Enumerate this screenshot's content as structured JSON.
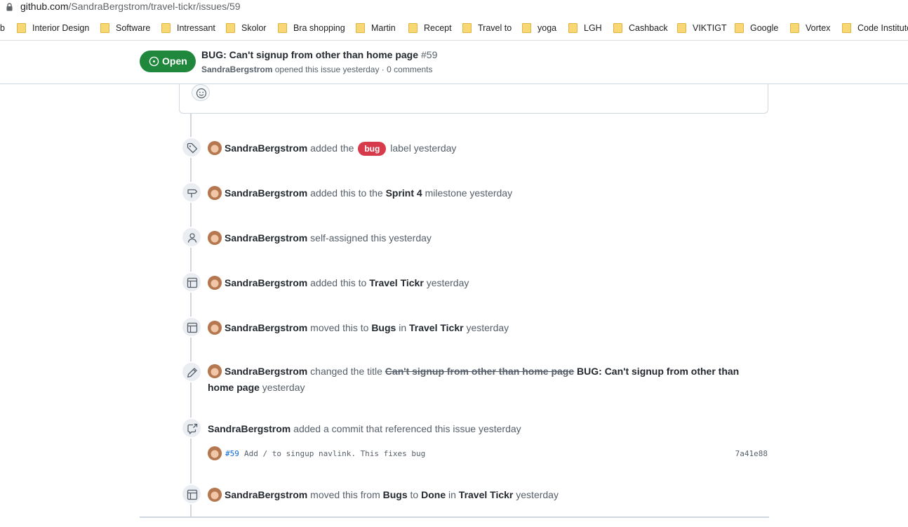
{
  "browser": {
    "url_host": "github.com",
    "url_path": "/SandraBergstrom/travel-tickr/issues/59",
    "bookmark_cut": "b",
    "bookmarks": [
      {
        "label": "Interior Design"
      },
      {
        "label": "Software"
      },
      {
        "label": "Intressant"
      },
      {
        "label": "Skolor"
      },
      {
        "label": "Bra shopping"
      },
      {
        "label": "Martin"
      },
      {
        "label": "Recept"
      },
      {
        "label": "Travel to"
      },
      {
        "label": "yoga"
      },
      {
        "label": "LGH"
      },
      {
        "label": "Cashback"
      },
      {
        "label": "VIKTIGT"
      },
      {
        "label": "Google"
      },
      {
        "label": "Vortex"
      },
      {
        "label": "Code Institute"
      }
    ]
  },
  "issue": {
    "state": "Open",
    "title": "BUG: Can't signup from other than home page",
    "number": "#59",
    "author": "SandraBergstrom",
    "meta_rest": "opened this issue yesterday · 0 comments",
    "state_color": "#1f883d"
  },
  "timeline": {
    "actor": "SandraBergstrom",
    "events": [
      {
        "icon": "tag-icon",
        "pre": "added the",
        "label": "bug",
        "post": "label yesterday",
        "label_color": "#d73a4a"
      },
      {
        "icon": "milestone-icon",
        "pre": "added this to the",
        "strong1": "Sprint 4",
        "post": "milestone yesterday"
      },
      {
        "icon": "person-icon",
        "pre": "self-assigned this yesterday"
      },
      {
        "icon": "project-icon",
        "pre": "added this to",
        "strong1": "Travel Tickr",
        "post": "yesterday"
      },
      {
        "icon": "project-icon",
        "pre": "moved this to",
        "strong1": "Bugs",
        "mid": "in",
        "strong2": "Travel Tickr",
        "post": "yesterday"
      },
      {
        "icon": "pencil-icon",
        "pre": "changed the title",
        "old_title": "Can't signup from other than home page",
        "new_title": "BUG: Can't signup from other than home page",
        "post": "yesterday"
      },
      {
        "icon": "cross-reference-icon",
        "pre": "added a commit that referenced this issue yesterday"
      },
      {
        "icon": "project-icon",
        "pre": "moved this from",
        "strong1": "Bugs",
        "mid": "to",
        "strong2": "Done",
        "mid2": "in",
        "strong3": "Travel Tickr",
        "post": "yesterday"
      }
    ],
    "commit": {
      "ref": "#59",
      "message": "Add / to singup navlink. This fixes bug",
      "sha": "7a41e88"
    }
  }
}
